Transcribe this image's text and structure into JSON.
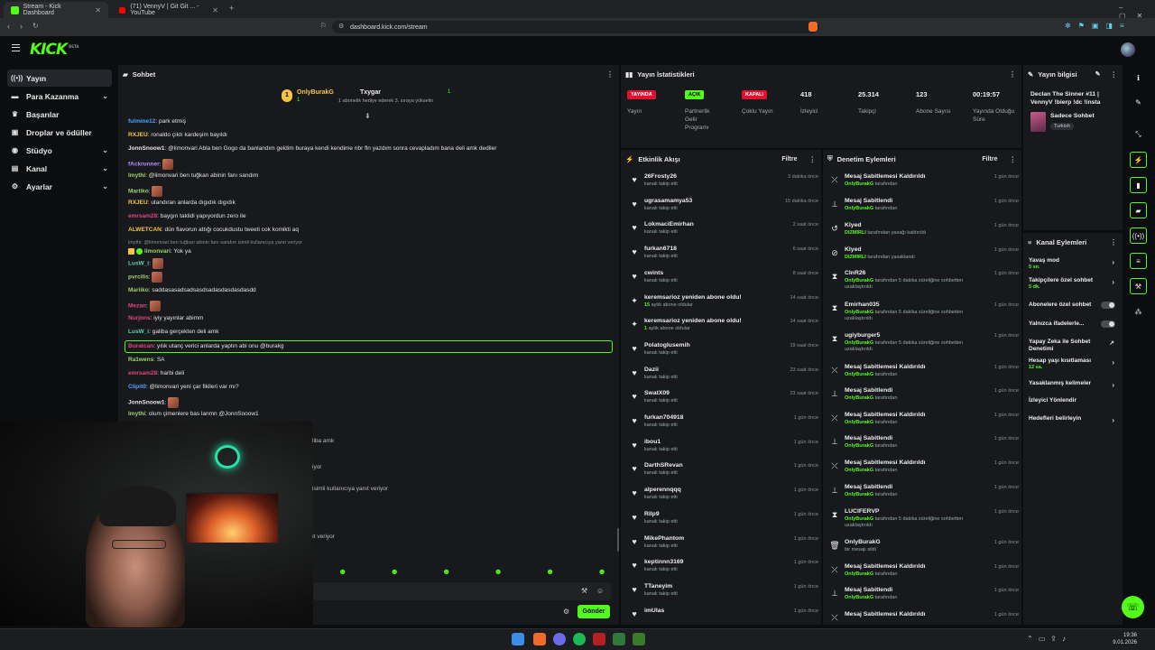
{
  "browser": {
    "tabs": [
      {
        "title": "Stream - Kick Dashboard"
      },
      {
        "title": "(71) VennyV | Git Git ... - YouTube"
      }
    ],
    "url": "dashboard.kick.com/stream"
  },
  "header": {
    "logo": "KICK",
    "logo_tag": "BETA"
  },
  "nav": [
    {
      "label": "Yayın",
      "icon": "broadcast-icon",
      "selected": true
    },
    {
      "label": "Para Kazanma",
      "icon": "money-icon",
      "chevron": true
    },
    {
      "label": "Başarılar",
      "icon": "trophy-icon"
    },
    {
      "label": "Droplar ve ödüller",
      "icon": "gift-icon"
    },
    {
      "label": "Stüdyo",
      "icon": "studio-icon",
      "chevron": true
    },
    {
      "label": "Kanal",
      "icon": "channel-icon",
      "chevron": true
    },
    {
      "label": "Ayarlar",
      "icon": "gear-icon",
      "chevron": true
    }
  ],
  "chat": {
    "title": "Sohbet",
    "pinned": {
      "rank": "1",
      "user1": "OnlyBurakG",
      "count1": "1",
      "user2": "Txygar",
      "count2": "1",
      "note": "1 abonelik hediye ederek 3. sıraya yükselin"
    },
    "messages": [
      {
        "user": "fulmine12",
        "color": "#4ea3ff",
        "text": "park etmiş"
      },
      {
        "user": "RXJEU",
        "color": "#f5c542",
        "text": "ronaldo çıktı kardeşim bayıldı"
      },
      {
        "user": "JonnSnoow1",
        "color": "#e6e6e6",
        "text": "@limonvari Abla ben Gogo da banlandım geldim buraya kendi kendime nbr fln yazdım sonra cevapladım bana deli amk dediler"
      },
      {
        "user": "fAckrunner",
        "color": "#b38cff",
        "text": ""
      },
      {
        "user": "lmythi",
        "color": "#9ad46a",
        "text": "@limonvari ben tuğkan abinin fanı sandım"
      },
      {
        "user": "Mariiko",
        "color": "#9ad46a",
        "text": ""
      },
      {
        "user": "RXJEU",
        "color": "#f5c542",
        "text": "utandıran anlarda dıgıdık dıgıdık"
      },
      {
        "user": "emrsam28",
        "color": "#e0457b",
        "text": "baygın taklidi yapıyordun zero ile"
      },
      {
        "user": "ALWETCAN",
        "color": "#f5c542",
        "text": "dün flavorun attığı cocukdustu tweeti cok komikti aq"
      },
      {
        "user": "limonvari",
        "color": "#9ad46a",
        "text": "Yok ya",
        "reply": "lmythi: @limonvari ben tuğkan abinin fanı sandım   isimli kullanıcıya yanıt veriyor"
      },
      {
        "user": "LusW_i",
        "color": "#5fd0a8",
        "text": ""
      },
      {
        "user": "pvrcilis",
        "color": "#9ad46a",
        "text": ""
      },
      {
        "user": "Mariiko",
        "color": "#9ad46a",
        "text": "saddasasadsadsasdsadasdasdasdasdd"
      },
      {
        "user": "Mezan",
        "color": "#e0457b",
        "text": ""
      },
      {
        "user": "Nurjons",
        "color": "#e0457b",
        "text": "iyiy yayınlar abimm"
      },
      {
        "user": "LusW_i",
        "color": "#5fd0a8",
        "text": "galiba gerçekten deli amk"
      },
      {
        "user": "Buratcan",
        "color": "#e0457b",
        "text": "yılık utanç verici anlarda yaptın abi onu @burakg"
      },
      {
        "user": "Ra1wens",
        "color": "#9ad46a",
        "text": "SA"
      },
      {
        "user": "emrsam28",
        "color": "#e0457b",
        "text": "harbi deli"
      },
      {
        "user": "Clipit0",
        "color": "#4ea3ff",
        "text": "@limonvari yeni çar fikileri var mı?"
      },
      {
        "user": "JonnSnoow1",
        "color": "#e6e6e6",
        "text": ""
      },
      {
        "user": "lmythi",
        "color": "#9ad46a",
        "text": "olum çimenlere bas lanmn @JonnSnoow1"
      }
    ],
    "partial": [
      "liba amk",
      "iyor",
      "isimli kullanıcıya yanıt veriyor",
      "ıt veriyor"
    ],
    "send_label": "Gönder"
  },
  "stats": {
    "title": "Yayın İstatistikleri",
    "items": [
      {
        "badge": "YAYINDA",
        "badge_color": "#e0102f",
        "label": "Yayın"
      },
      {
        "badge": "AÇIK",
        "badge_color": "#53fc18",
        "label": "Partnerlik Gelir Programı"
      },
      {
        "badge": "KAPALI",
        "badge_color": "#e0102f",
        "label": "Çoklu Yayın"
      },
      {
        "value": "418",
        "label": "İzleyici"
      },
      {
        "value": "25.314",
        "label": "Takipçi"
      },
      {
        "value": "123",
        "label": "Abone Sayısı"
      },
      {
        "value": "00:19:57",
        "label": "Yayında Olduğu Süre"
      }
    ]
  },
  "activity": {
    "title": "Etkinlik Akışı",
    "filter": "Filtre",
    "items": [
      {
        "icon": "heart",
        "name": "26Frosty26",
        "sub": "kanalı takip etti",
        "time": "3 dakika önce"
      },
      {
        "icon": "heart",
        "name": "ugrasamamya53",
        "sub": "kanalı takip etti",
        "time": "15 dakika önce"
      },
      {
        "icon": "heart",
        "name": "LokmaciEmirhan",
        "sub": "kanalı takip etti",
        "time": "2 saat önce"
      },
      {
        "icon": "heart",
        "name": "furkan6718",
        "sub": "kanalı takip etti",
        "time": "6 saat önce"
      },
      {
        "icon": "heart",
        "name": "cwints",
        "sub": "kanalı takip etti",
        "time": "8 saat önce"
      },
      {
        "icon": "star",
        "name": "keremsarioz yeniden abone oldu!",
        "sub_hl": "15",
        "sub": " aylık abone oldular",
        "time": "14 saat önce"
      },
      {
        "icon": "star",
        "name": "keremsarioz yeniden abone oldu!",
        "sub_hl": "1",
        "sub": " aylık abone oldular",
        "time": "14 saat önce"
      },
      {
        "icon": "heart",
        "name": "Polatoglusemih",
        "sub": "kanalı takip etti",
        "time": "19 saat önce"
      },
      {
        "icon": "heart",
        "name": "Dazii",
        "sub": "kanalı takip etti",
        "time": "23 saat önce"
      },
      {
        "icon": "heart",
        "name": "SwatX09",
        "sub": "kanalı takip etti",
        "time": "23 saat önce"
      },
      {
        "icon": "heart",
        "name": "furkan704918",
        "sub": "kanalı takip etti",
        "time": "1 gün önce"
      },
      {
        "icon": "heart",
        "name": "ibou1",
        "sub": "kanalı takip etti",
        "time": "1 gün önce"
      },
      {
        "icon": "heart",
        "name": "DarthSRevan",
        "sub": "kanalı takip etti",
        "time": "1 gün önce"
      },
      {
        "icon": "heart",
        "name": "alperennqqq",
        "sub": "kanalı takip etti",
        "time": "1 gün önce"
      },
      {
        "icon": "heart",
        "name": "Rilp9",
        "sub": "kanalı takip etti",
        "time": "1 gün önce"
      },
      {
        "icon": "heart",
        "name": "MikePhantom",
        "sub": "kanalı takip etti",
        "time": "1 gün önce"
      },
      {
        "icon": "heart",
        "name": "keptinnn3169",
        "sub": "kanalı takip etti",
        "time": "1 gün önce"
      },
      {
        "icon": "heart",
        "name": "TTaneyim",
        "sub": "kanalı takip etti",
        "time": "1 gün önce"
      },
      {
        "icon": "heart",
        "name": "imUlas",
        "sub": "",
        "time": "1 gün önce"
      }
    ]
  },
  "moderation": {
    "title": "Denetim Eylemleri",
    "filter": "Filtre",
    "items": [
      {
        "icon": "unpin",
        "name": "Mesaj Sabitlemesi Kaldırıldı",
        "who": "OnlyBurakG",
        "sub": " tarafından",
        "time": "1 gün önce"
      },
      {
        "icon": "pin",
        "name": "Mesaj Sabitlendi",
        "who": "OnlyBurakG",
        "sub": " tarafından",
        "time": "1 gün önce"
      },
      {
        "icon": "undo",
        "name": "Klyed",
        "who": "DIZMIRLI",
        "sub": " tarafından yasağı kaldırıldı",
        "time": "1 gün önce"
      },
      {
        "icon": "ban",
        "name": "Klyed",
        "who": "DIZMIRLI",
        "sub": " tarafından yasaklandı",
        "time": "1 gün önce"
      },
      {
        "icon": "timer",
        "name": "CInR26",
        "who": "OnlyBurakG",
        "sub": " tarafından 5 dakika süreliğine sohbetten uzaklaştırıldı",
        "time": "1 gün önce"
      },
      {
        "icon": "timer",
        "name": "Emirhan035",
        "who": "OnlyBurakG",
        "sub": " tarafından 5 dakika süreliğine sohbetten uzaklaştırıldı",
        "time": "1 gün önce"
      },
      {
        "icon": "timer",
        "name": "ugiyburger5",
        "who": "OnlyBurakG",
        "sub": " tarafından 5 dakika süreliğine sohbetten uzaklaştırıldı",
        "time": "1 gün önce"
      },
      {
        "icon": "unpin",
        "name": "Mesaj Sabitlemesi Kaldırıldı",
        "who": "OnlyBurakG",
        "sub": " tarafından",
        "time": "1 gün önce"
      },
      {
        "icon": "pin",
        "name": "Mesaj Sabitlendi",
        "who": "OnlyBurakG",
        "sub": " tarafından",
        "time": "1 gün önce"
      },
      {
        "icon": "unpin",
        "name": "Mesaj Sabitlemesi Kaldırıldı",
        "who": "OnlyBurakG",
        "sub": " tarafından",
        "time": "1 gün önce"
      },
      {
        "icon": "pin",
        "name": "Mesaj Sabitlendi",
        "who": "OnlyBurakG",
        "sub": " tarafından",
        "time": "1 gün önce"
      },
      {
        "icon": "unpin",
        "name": "Mesaj Sabitlemesi Kaldırıldı",
        "who": "OnlyBurakG",
        "sub": " tarafından",
        "time": "1 gün önce"
      },
      {
        "icon": "pin",
        "name": "Mesaj Sabitlendi",
        "who": "OnlyBurakG",
        "sub": " tarafından",
        "time": "1 gün önce"
      },
      {
        "icon": "timer",
        "name": "LUCIFERVP",
        "who": "OnlyBurakG",
        "sub": " tarafından 5 dakika süreliğine sohbetten uzaklaştırıldı",
        "time": "1 gün önce"
      },
      {
        "icon": "trash",
        "name": "OnlyBurakG",
        "who": "",
        "sub": "bir mesajı sildi",
        "time": "1 gün önce"
      },
      {
        "icon": "unpin",
        "name": "Mesaj Sabitlemesi Kaldırıldı",
        "who": "OnlyBurakG",
        "sub": " tarafından",
        "time": "1 gün önce"
      },
      {
        "icon": "pin",
        "name": "Mesaj Sabitlendi",
        "who": "OnlyBurakG",
        "sub": " tarafından",
        "time": "1 gün önce"
      },
      {
        "icon": "unpin",
        "name": "Mesaj Sabitlemesi Kaldırıldı",
        "who": "",
        "sub": "",
        "time": "1 gün önce"
      }
    ]
  },
  "stream_info": {
    "title": "Yayın bilgisi",
    "stream_title": "Declan The Sinner #11 | VennyV !bierp !dc !insta",
    "category": "Sadece Sohbet",
    "tag": "Turkish"
  },
  "channel_actions": {
    "title": "Kanal Eylemleri",
    "items": [
      {
        "label": "Yavaş mod",
        "sub": "5 sn.",
        "kind": "chevron"
      },
      {
        "label": "Takipçilere özel sohbet",
        "sub": "5 dk.",
        "kind": "chevron"
      },
      {
        "label": "Abonelere özel sohbet",
        "sub": "",
        "kind": "toggle"
      },
      {
        "label": "Yalnızca ifadelerle...",
        "sub": "",
        "kind": "toggle"
      },
      {
        "label": "Yapay Zeka ile Sohbet Denetimi",
        "sub": "",
        "kind": "link"
      },
      {
        "label": "Hesap yaşı kısıtlaması",
        "sub": "12 sa.",
        "kind": "chevron"
      },
      {
        "label": "Yasaklanmış kelimeler",
        "sub": "",
        "kind": "chevron"
      },
      {
        "label": "İzleyici Yönlendir",
        "sub": "",
        "kind": "none"
      },
      {
        "label": "Hedefleri belirleyin",
        "sub": "",
        "kind": "chevron"
      }
    ]
  },
  "taskbar": {
    "time": "19:36",
    "date": "9.01.2026"
  },
  "colors": {
    "accent": "#53fc18",
    "live": "#e0102f",
    "panel": "#18191d",
    "bg": "#0b0d0f"
  }
}
